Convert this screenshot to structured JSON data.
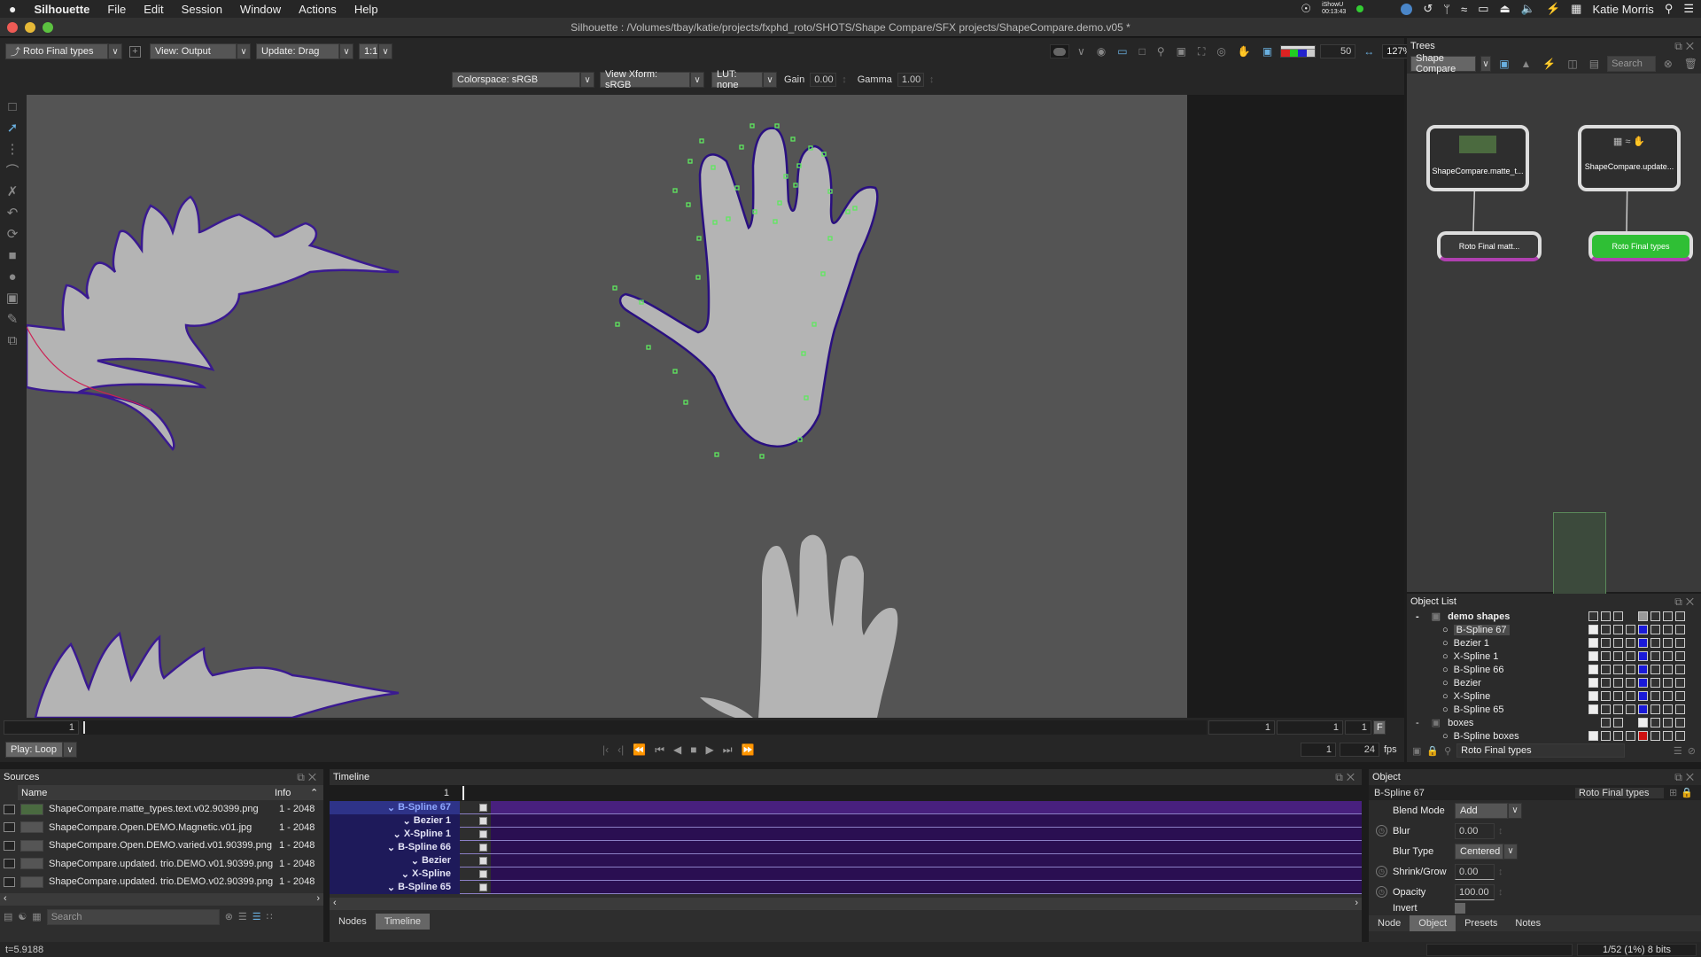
{
  "menubar": {
    "apple_icon": "",
    "app_name": "Silhouette",
    "items": [
      "File",
      "Edit",
      "Session",
      "Window",
      "Actions",
      "Help"
    ],
    "right": {
      "ishowu_label": "iShowU",
      "ishowu_time": "00:13:43",
      "user": "Katie Morris"
    }
  },
  "window": {
    "title": "Silhouette : /Volumes/tbay/katie/projects/fxphd_roto/SHOTS/Shape Compare/SFX projects/ShapeCompare.demo.v05 *"
  },
  "toolbar": {
    "node_select": "Roto Final types",
    "view": "View: Output",
    "update": "Update: Drag",
    "ratio": "1:1",
    "colorspace": "Colorspace: sRGB",
    "view_xform": "View Xform: sRGB",
    "lut": "LUT: none",
    "gain_label": "Gain",
    "gain_value": "0.00",
    "gamma_label": "Gamma",
    "gamma_value": "1.00",
    "brightness_value": "50",
    "zoom_value": "127%"
  },
  "playback": {
    "current_frame": "1",
    "play_mode": "Play: Loop",
    "range_fields": [
      "1",
      "1",
      "1"
    ],
    "f_button": "F",
    "step_value": "1",
    "fps_value": "24",
    "fps_label": "fps"
  },
  "sources": {
    "title": "Sources",
    "columns": [
      "Name",
      "Info"
    ],
    "rows": [
      {
        "name": "ShapeCompare.matte_types.text.v02.90399.png",
        "info": "1 - 2048"
      },
      {
        "name": "ShapeCompare.Open.DEMO.Magnetic.v01.jpg",
        "info": "1 - 2048"
      },
      {
        "name": "ShapeCompare.Open.DEMO.varied.v01.90399.png",
        "info": "1 - 2048"
      },
      {
        "name": "ShapeCompare.updated. trio.DEMO.v01.90399.png",
        "info": "1 - 2048"
      },
      {
        "name": "ShapeCompare.updated. trio.DEMO.v02.90399.png",
        "info": "1 - 2048"
      }
    ],
    "search_placeholder": "Search"
  },
  "timeline": {
    "title": "Timeline",
    "frame": "1",
    "rows": [
      "B-Spline 67",
      "Bezier 1",
      "X-Spline 1",
      "B-Spline 66",
      "Bezier",
      "X-Spline",
      "B-Spline 65"
    ],
    "tabs": [
      "Nodes",
      "Timeline"
    ],
    "active_tab": "Timeline"
  },
  "trees": {
    "title": "Trees",
    "tree_select": "Shape Compare",
    "search_placeholder": "Search",
    "nodes": [
      {
        "label": "ShapeCompare.matte_t..."
      },
      {
        "label": "ShapeCompare.update..."
      },
      {
        "label": "Roto Final matt..."
      },
      {
        "label": "Roto Final types"
      }
    ]
  },
  "object_list": {
    "title": "Object List",
    "groups": [
      {
        "name": "demo shapes",
        "items": [
          "B-Spline 67",
          "Bezier 1",
          "X-Spline 1",
          "B-Spline 66",
          "Bezier",
          "X-Spline",
          "B-Spline 65"
        ]
      },
      {
        "name": "boxes",
        "items": [
          "B-Spline boxes"
        ]
      }
    ],
    "selected": "B-Spline 67",
    "footer_node": "Roto Final types",
    "colors": {
      "shape": "#1a1ad8",
      "boxes": "#cc1111"
    }
  },
  "object": {
    "title": "Object",
    "object_name": "B-Spline 67",
    "node_name": "Roto Final types",
    "props": [
      {
        "label": "Blend Mode",
        "value": "Add",
        "type": "dropdown",
        "anim": false
      },
      {
        "label": "Blur",
        "value": "0.00",
        "type": "number",
        "anim": true
      },
      {
        "label": "Blur Type",
        "value": "Centered",
        "type": "dropdown",
        "anim": false
      },
      {
        "label": "Shrink/Grow",
        "value": "0.00",
        "type": "number",
        "anim": true
      },
      {
        "label": "Opacity",
        "value": "100.00",
        "type": "number",
        "anim": true
      },
      {
        "label": "Invert",
        "value": "",
        "type": "checkbox",
        "anim": false
      }
    ],
    "tabs": [
      "Node",
      "Object",
      "Presets",
      "Notes"
    ],
    "active_tab": "Object"
  },
  "status": {
    "time": "t=5.9188",
    "cache": "1/52 (1%) 8 bits"
  }
}
